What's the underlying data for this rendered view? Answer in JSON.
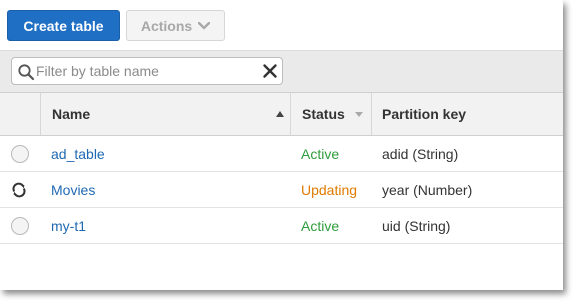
{
  "toolbar": {
    "create_label": "Create table",
    "actions_label": "Actions"
  },
  "filter": {
    "placeholder": "Filter by table name",
    "value": ""
  },
  "table": {
    "columns": {
      "name": "Name",
      "status": "Status",
      "partition_key": "Partition key"
    },
    "rows": [
      {
        "name": "ad_table",
        "status": "Active",
        "partition_key": "adid (String)",
        "indicator": "radio"
      },
      {
        "name": "Movies",
        "status": "Updating",
        "partition_key": "year (Number)",
        "indicator": "refresh-icon"
      },
      {
        "name": "my-t1",
        "status": "Active",
        "partition_key": "uid (String)",
        "indicator": "radio"
      }
    ]
  },
  "colors": {
    "primary": "#1f6fc5",
    "link": "#1f68b3",
    "status_active": "#2e9e3e",
    "status_updating": "#e07b00"
  },
  "icons": {
    "search": "search-icon",
    "clear": "close-icon",
    "actions_caret": "chevron-down-icon",
    "sort_name": "sort-ascending-icon",
    "sort_status": "sort-descending-icon",
    "updating": "refresh-icon"
  }
}
